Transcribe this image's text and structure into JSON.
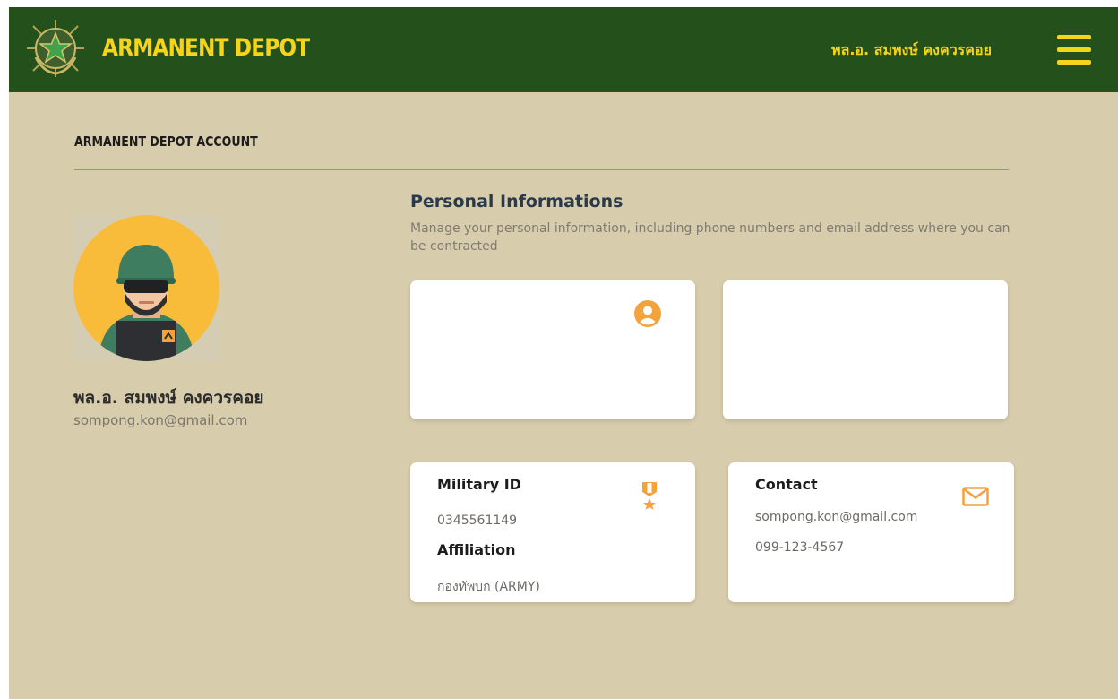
{
  "header": {
    "brand": "ARMANENT DEPOT",
    "user_name": "พล.อ. สมพงษ์ คงควรคอย",
    "brand_color": "#f5d419",
    "background_color": "#23501b"
  },
  "page": {
    "title": "ARMANENT DEPOT ACCOUNT"
  },
  "profile": {
    "name": "พล.อ. สมพงษ์ คงควรคอย",
    "email": "sompong.kon@gmail.com",
    "avatar_icon": "soldier-avatar"
  },
  "personal_info": {
    "title": "Personal Informations",
    "description": "Manage your personal information, including phone numbers and email address where you can be contracted"
  },
  "cards": {
    "profile_card": {
      "icon": "user-circle-icon"
    },
    "blank_card": {},
    "military": {
      "id_label": "Military ID",
      "id_value": "0345561149",
      "affiliation_label": "Affiliation",
      "affiliation_value": "กองทัพบก (ARMY)",
      "icon": "medal-icon"
    },
    "contact": {
      "label": "Contact",
      "email": "sompong.kon@gmail.com",
      "phone": "099-123-4567",
      "icon": "mail-icon"
    }
  },
  "colors": {
    "page_background": "#d7ccab",
    "accent_orange": "#f4a23b",
    "avatar_background": "#f9bb3a"
  }
}
